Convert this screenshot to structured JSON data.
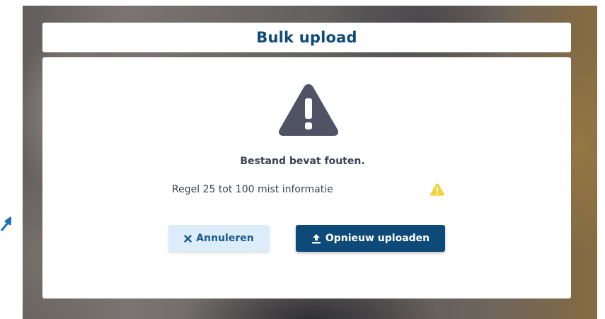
{
  "dialog": {
    "title": "Bulk upload",
    "status_icon": "warning-triangle-icon",
    "heading": "Bestand bevat fouten.",
    "error_message": "Regel 25 tot 100 mist informatie",
    "error_icon": "warning-icon",
    "cancel_button": {
      "label": "Annuleren",
      "icon": "close-icon"
    },
    "reupload_button": {
      "label": "Opnieuw uploaden",
      "icon": "upload-icon"
    }
  },
  "colors": {
    "brand_dark_blue": "#0d4a78",
    "cancel_bg": "#dcedf9",
    "warning_gray": "#4f5364",
    "warning_yellow": "#f2d23a",
    "text": "#3d4250"
  },
  "background": {
    "corner_icon": "arrow-up-right-icon"
  }
}
